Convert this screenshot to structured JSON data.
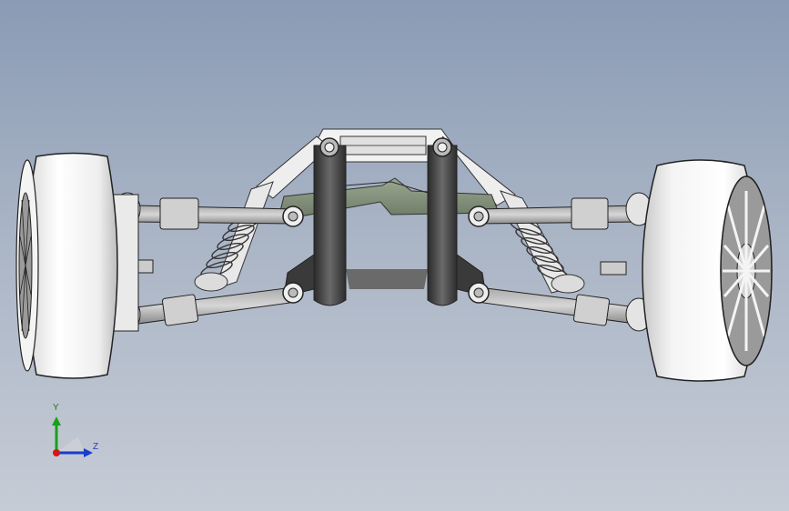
{
  "viewport": {
    "background_top": "#8a9bb5",
    "background_bottom": "#c6ccd6"
  },
  "triad": {
    "y_label": "Y",
    "z_label": "Z",
    "y_color": "#1aa01a",
    "z_color": "#1a3ccc",
    "x_color": "#d01818"
  }
}
